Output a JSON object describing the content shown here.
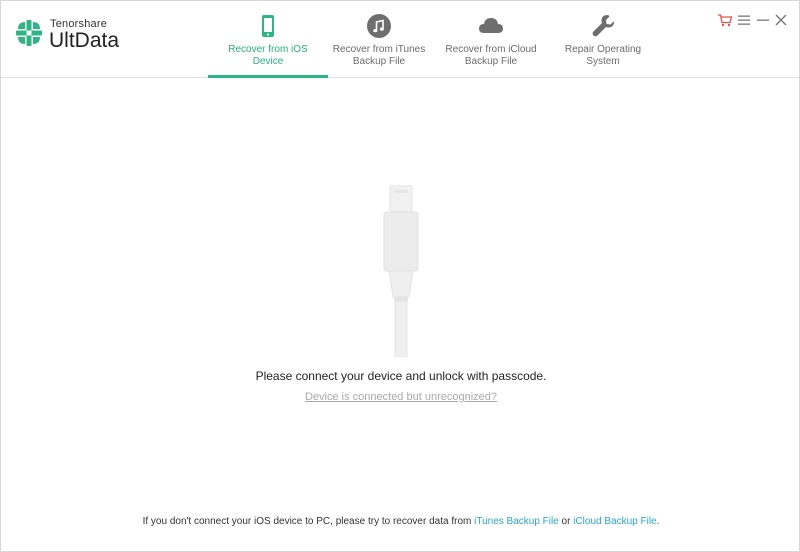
{
  "app": {
    "brand_small": "Tenorshare",
    "brand_big": "UltData"
  },
  "tabs": [
    {
      "label": "Recover from iOS\nDevice",
      "icon": "phone-icon",
      "active": true
    },
    {
      "label": "Recover from iTunes\nBackup File",
      "icon": "music-icon",
      "active": false
    },
    {
      "label": "Recover from iCloud\nBackup File",
      "icon": "cloud-icon",
      "active": false
    },
    {
      "label": "Repair Operating\nSystem",
      "icon": "wrench-icon",
      "active": false
    }
  ],
  "window_controls": [
    "cart-icon",
    "menu-icon",
    "minimize-icon",
    "close-icon"
  ],
  "main": {
    "connect_message": "Please connect your device and unlock with passcode.",
    "unrecognized_link": "Device is connected but unrecognized?"
  },
  "footer": {
    "prefix": "If you don't connect your iOS device to PC, please try to recover data from ",
    "itunes_link": "iTunes Backup File",
    "middle": " or ",
    "icloud_link": "iCloud Backup File",
    "suffix": "."
  },
  "colors": {
    "accent_green": "#2bb683",
    "link_blue": "#27a8c8",
    "icon_gray": "#6e6e6e",
    "cart_red": "#e0534f"
  }
}
